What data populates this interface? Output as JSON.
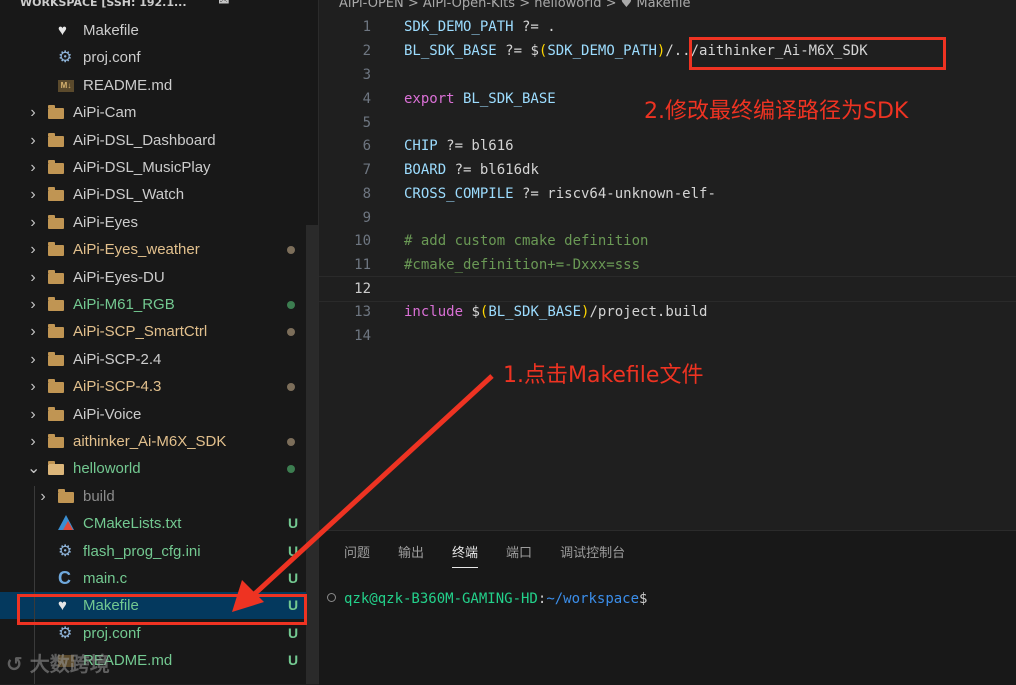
{
  "workspace_title": "WORKSPACE [SSH: 192.1...",
  "breadcrumb": [
    "AiPi-OPEN",
    "AiPi-Open-Kits",
    "helloworld",
    "Makefile"
  ],
  "explorer": [
    {
      "label": "Makefile",
      "icon": "makefile-icon",
      "color": "#cccccc"
    },
    {
      "label": "proj.conf",
      "icon": "gear-icon",
      "color": "#cccccc"
    },
    {
      "label": "README.md",
      "icon": "markdown-icon",
      "icon_text": "M↓",
      "color": "#cccccc"
    },
    {
      "label": "AiPi-Cam",
      "icon": "folder-icon",
      "color": "#cccccc"
    },
    {
      "label": "AiPi-DSL_Dashboard",
      "icon": "folder-icon",
      "color": "#cccccc"
    },
    {
      "label": "AiPi-DSL_MusicPlay",
      "icon": "folder-icon",
      "color": "#cccccc"
    },
    {
      "label": "AiPi-DSL_Watch",
      "icon": "folder-icon",
      "color": "#cccccc"
    },
    {
      "label": "AiPi-Eyes",
      "icon": "folder-icon",
      "color": "#cccccc"
    },
    {
      "label": "AiPi-Eyes_weather",
      "icon": "folder-icon",
      "color": "#e2c08d",
      "dot": "#7c6e5a"
    },
    {
      "label": "AiPi-Eyes-DU",
      "icon": "folder-icon",
      "color": "#cccccc"
    },
    {
      "label": "AiPi-M61_RGB",
      "icon": "folder-icon",
      "color": "#73c991",
      "dot": "#3c7d50"
    },
    {
      "label": "AiPi-SCP_SmartCtrl",
      "icon": "folder-icon",
      "color": "#e2c08d",
      "dot": "#7c6e5a"
    },
    {
      "label": "AiPi-SCP-2.4",
      "icon": "folder-icon",
      "color": "#cccccc"
    },
    {
      "label": "AiPi-SCP-4.3",
      "icon": "folder-icon",
      "color": "#e2c08d",
      "dot": "#7c6e5a"
    },
    {
      "label": "AiPi-Voice",
      "icon": "folder-icon",
      "color": "#cccccc"
    },
    {
      "label": "aithinker_Ai-M6X_SDK",
      "icon": "folder-icon",
      "color": "#e2c08d",
      "dot": "#7c6e5a"
    },
    {
      "label": "helloworld",
      "icon": "folder-open-icon",
      "color": "#73c991",
      "dot": "#3c7d50"
    },
    {
      "label": "build",
      "icon": "folder-icon",
      "color": "#8c8c8c"
    },
    {
      "label": "CMakeLists.txt",
      "icon": "cmake-icon",
      "color": "#73c991",
      "badge": "U"
    },
    {
      "label": "flash_prog_cfg.ini",
      "icon": "gear-icon",
      "color": "#73c991",
      "badge": "U"
    },
    {
      "label": "main.c",
      "icon": "c-icon",
      "icon_text": "C",
      "color": "#73c991",
      "badge": "U"
    },
    {
      "label": "Makefile",
      "icon": "makefile-icon",
      "color": "#73c991",
      "badge": "U"
    },
    {
      "label": "proj.conf",
      "icon": "gear-icon",
      "color": "#73c991",
      "badge": "U"
    },
    {
      "label": "README.md",
      "icon": "markdown-icon",
      "color": "#73c991",
      "badge": "U"
    }
  ],
  "code": {
    "line_numbers": [
      "1",
      "2",
      "3",
      "4",
      "5",
      "6",
      "7",
      "8",
      "9",
      "10",
      "11",
      "12",
      "13",
      "14"
    ],
    "l1": {
      "var": "SDK_DEMO_PATH",
      "op": " ?= ."
    },
    "l2": {
      "var": "BL_SDK_BASE",
      "op": " ?= ",
      "dollar": "$",
      "open": "(",
      "inner": "SDK_DEMO_PATH",
      "close": ")",
      "rest": "/../aithinker_Ai-M6X_SDK"
    },
    "l4": {
      "kw": "export",
      "var": " BL_SDK_BASE"
    },
    "l6": {
      "var": "CHIP",
      "op": " ?= bl616"
    },
    "l7": {
      "var": "BOARD",
      "op": " ?= bl616dk"
    },
    "l8": {
      "var": "CROSS_COMPILE",
      "op": " ?= riscv64-unknown-elf-"
    },
    "l10": "# add custom cmake definition",
    "l11": "#cmake_definition+=-Dxxx=sss",
    "l13": {
      "kw": "include",
      "dollar": " $",
      "open": "(",
      "inner": "BL_SDK_BASE",
      "close": ")",
      "rest": "/project.build"
    }
  },
  "panel": {
    "tabs": [
      "问题",
      "输出",
      "终端",
      "端口",
      "调试控制台"
    ],
    "active_tab": "终端",
    "terminal": {
      "user": "qzk@qzk-B360M-GAMING-HD",
      "sep": ":",
      "path": "~/workspace",
      "dollar": "$"
    }
  },
  "annotations": {
    "step1": "1.点击Makefile文件",
    "step2": "2.修改最终编译路径为SDK",
    "color": "#ee3322"
  },
  "watermark": "大数跨境"
}
